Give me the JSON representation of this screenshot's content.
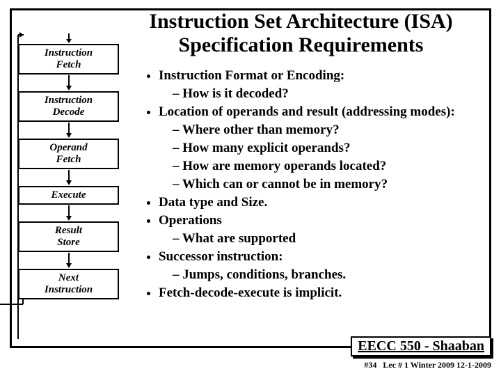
{
  "title_line1": "Instruction Set Architecture (ISA)",
  "title_line2": "Specification Requirements",
  "stages": {
    "s0a": "Instruction",
    "s0b": "Fetch",
    "s1a": "Instruction",
    "s1b": "Decode",
    "s2a": "Operand",
    "s2b": "Fetch",
    "s3": "Execute",
    "s4a": "Result",
    "s4b": "Store",
    "s5a": "Next",
    "s5b": "Instruction"
  },
  "bullets": {
    "b0": "Instruction Format or Encoding:",
    "b0s0": "– How is it decoded?",
    "b1": "Location of operands and result (addressing modes):",
    "b1s0": "– Where other than memory?",
    "b1s1": "– How many explicit operands?",
    "b1s2": "– How are memory operands located?",
    "b1s3": "– Which can or cannot be in memory?",
    "b2": "Data type and Size.",
    "b3": " Operations",
    "b3s0": "– What are supported",
    "b4": "Successor instruction:",
    "b4s0": "– Jumps, conditions, branches.",
    "b5": "Fetch-decode-execute is implicit."
  },
  "footer": {
    "course": "EECC 550 ",
    "dash": "- ",
    "author": "Shaaban",
    "page": "#34",
    "lec": "Lec # 1 Winter 2009 12-1-2009"
  }
}
